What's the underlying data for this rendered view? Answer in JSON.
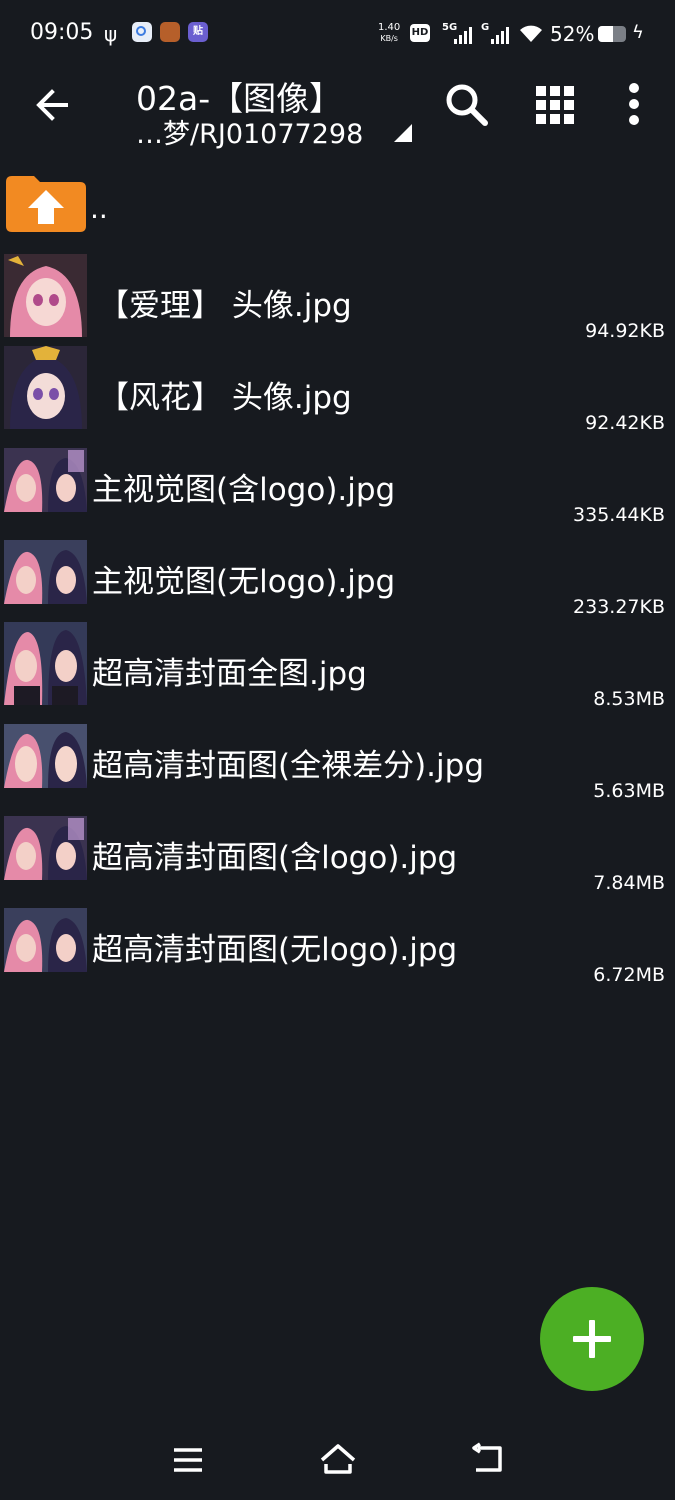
{
  "status_bar": {
    "time": "09:05",
    "net_speed_value": "1.40",
    "net_speed_unit": "KB/s",
    "hd_badge": "HD",
    "signal1_label": "5G",
    "signal2_label": "G",
    "battery_percent": "52%",
    "battery_level": 0.52,
    "usb_symbol": "ψ",
    "app3_label": "贴",
    "charging_symbol": "ϟ"
  },
  "toolbar": {
    "title": "02a-【图像】",
    "subtitle": "…梦/RJ01077298"
  },
  "file_list": {
    "parent_label": "..",
    "items": [
      {
        "name": "【爱理】 头像.jpg",
        "size": "94.92KB"
      },
      {
        "name": "【风花】 头像.jpg",
        "size": "92.42KB"
      },
      {
        "name": "主视觉图(含logo).jpg",
        "size": "335.44KB"
      },
      {
        "name": "主视觉图(无logo).jpg",
        "size": "233.27KB"
      },
      {
        "name": "超高清封面全图.jpg",
        "size": "8.53MB"
      },
      {
        "name": "超高清封面图(全裸差分).jpg",
        "size": "5.63MB"
      },
      {
        "name": "超高清封面图(含logo).jpg",
        "size": "7.84MB"
      },
      {
        "name": "超高清封面图(无logo).jpg",
        "size": "6.72MB"
      }
    ]
  },
  "colors": {
    "background": "#171a1f",
    "fab": "#4caf24",
    "folder": "#f28a22"
  },
  "icons": {
    "back": "arrow-left-icon",
    "search": "search-icon",
    "grid": "grid-view-icon",
    "more": "more-vert-icon",
    "fab": "plus-icon",
    "parent": "folder-up-icon"
  }
}
